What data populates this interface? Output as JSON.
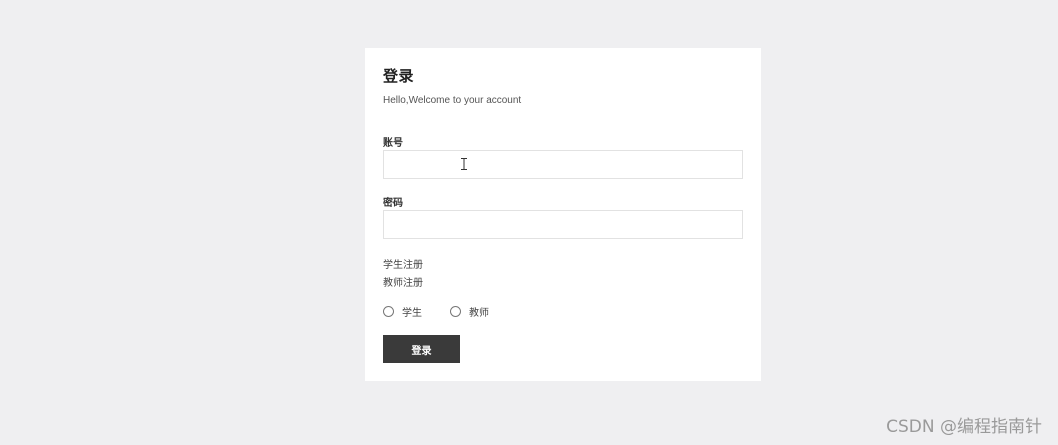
{
  "card": {
    "title": "登录",
    "subtitle": "Hello,Welcome to your account"
  },
  "form": {
    "account_label": "账号",
    "account_value": "",
    "password_label": "密码",
    "password_value": ""
  },
  "links": {
    "student_register": "学生注册",
    "teacher_register": "教师注册"
  },
  "role": {
    "options": [
      "学生",
      "教师"
    ],
    "selected": null
  },
  "submit_label": "登录",
  "watermark": "CSDN @编程指南针",
  "colors": {
    "background": "#efeff1",
    "card": "#ffffff",
    "button": "#3a3a3a",
    "button_text": "#ffffff"
  }
}
